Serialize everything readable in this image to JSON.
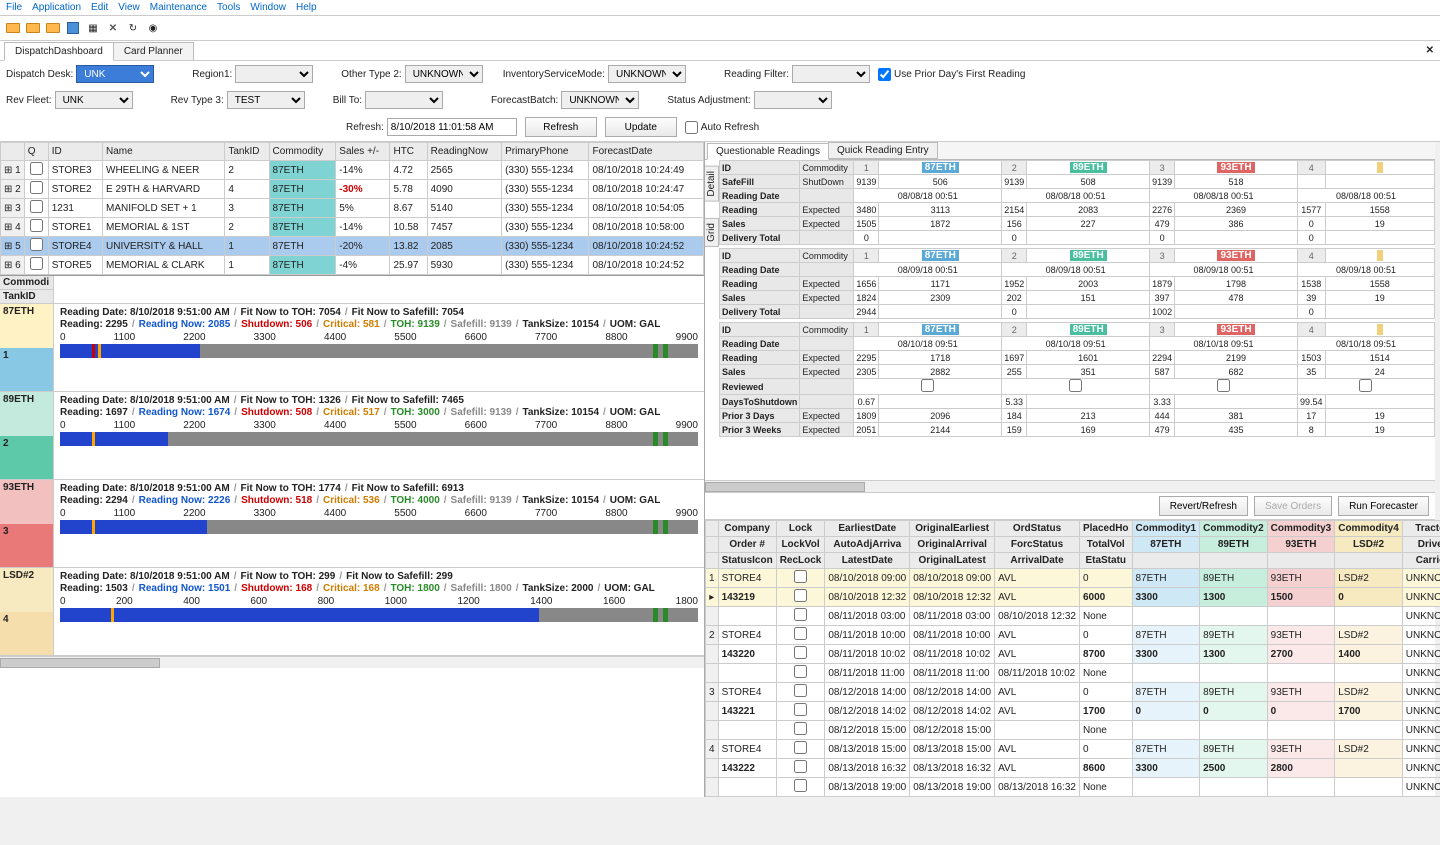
{
  "menu": [
    "File",
    "Application",
    "Edit",
    "View",
    "Maintenance",
    "Tools",
    "Window",
    "Help"
  ],
  "tabs": {
    "dispatch": "DispatchDashboard",
    "card": "Card Planner"
  },
  "filter": {
    "desk_lbl": "Dispatch Desk:",
    "desk": "UNK",
    "region_lbl": "Region1:",
    "region": "",
    "ot2_lbl": "Other Type 2:",
    "ot2": "UNKNOWN",
    "ism_lbl": "InventoryServiceMode:",
    "ism": "UNKNOWN",
    "rf_lbl": "Reading Filter:",
    "rf": "",
    "prior_lbl": "Use Prior Day's First Reading",
    "fleet_lbl": "Rev Fleet:",
    "fleet": "UNK",
    "rt3_lbl": "Rev Type 3:",
    "rt3": "TEST",
    "bill_lbl": "Bill To:",
    "bill": "",
    "fb_lbl": "ForecastBatch:",
    "fb": "UNKNOWN",
    "sa_lbl": "Status Adjustment:",
    "sa": "",
    "refresh_lbl": "Refresh:",
    "refresh_time": "8/10/2018 11:01:58 AM",
    "btn_refresh": "Refresh",
    "btn_update": "Update",
    "auto": "Auto Refresh"
  },
  "grid_cols": [
    "",
    "Q",
    "ID",
    "Name",
    "TankID",
    "Commodity",
    "Sales +/-",
    "HTC",
    "ReadingNow",
    "PrimaryPhone",
    "ForecastDate"
  ],
  "grid_rows": [
    {
      "n": "1",
      "id": "STORE3",
      "name": "WHEELING & NEER",
      "tank": "2",
      "com": "87ETH",
      "sales": "-14%",
      "htc": "4.72",
      "rn": "2565",
      "ph": "(330) 555-1234",
      "fd": "08/10/2018 10:24:49"
    },
    {
      "n": "2",
      "id": "STORE2",
      "name": "E 29TH & HARVARD",
      "tank": "4",
      "com": "87ETH",
      "sales": "-30%",
      "red": true,
      "htc": "5.78",
      "rn": "4090",
      "ph": "(330) 555-1234",
      "fd": "08/10/2018 10:24:47"
    },
    {
      "n": "3",
      "id": "1231",
      "name": "MANIFOLD SET + 1",
      "tank": "3",
      "com": "87ETH",
      "sales": "5%",
      "htc": "8.67",
      "rn": "5140",
      "ph": "(330) 555-1234",
      "fd": "08/10/2018 10:54:05"
    },
    {
      "n": "4",
      "id": "STORE1",
      "name": "MEMORIAL & 1ST",
      "tank": "2",
      "com": "87ETH",
      "sales": "-14%",
      "htc": "10.58",
      "rn": "7457",
      "ph": "(330) 555-1234",
      "fd": "08/10/2018 10:58:00"
    },
    {
      "n": "5",
      "id": "STORE4",
      "name": "UNIVERSITY & HALL",
      "tank": "1",
      "com": "87ETH",
      "sales": "-20%",
      "htc": "13.82",
      "rn": "2085",
      "ph": "(330) 555-1234",
      "fd": "08/10/2018 10:24:52",
      "sel": true
    },
    {
      "n": "6",
      "id": "STORE5",
      "name": "MEMORIAL & CLARK",
      "tank": "1",
      "com": "87ETH",
      "sales": "-4%",
      "htc": "25.97",
      "rn": "5930",
      "ph": "(330) 555-1234",
      "fd": "08/10/2018 10:24:52"
    }
  ],
  "chart_hdr": {
    "com": "Commodi",
    "tank": "TankID"
  },
  "tanks": [
    {
      "code": "87ETH",
      "num": "1",
      "cls": "c87",
      "rdate": "8/10/2018 9:51:00 AM",
      "toh": "7054",
      "sf": "7054",
      "read": "2295",
      "rn": "2085",
      "shut": "506",
      "crit": "581",
      "tohv": "9139",
      "safe": "9139",
      "size": "10154",
      "uom": "GAL",
      "pct": 22,
      "shutp": 5,
      "critp": 6,
      "ticks": [
        "0",
        "1100",
        "2200",
        "3300",
        "4400",
        "5500",
        "6600",
        "7700",
        "8800",
        "9900"
      ]
    },
    {
      "code": "89ETH",
      "num": "2",
      "cls": "c89",
      "rdate": "8/10/2018 9:51:00 AM",
      "toh": "1326",
      "sf": "7465",
      "read": "1697",
      "rn": "1674",
      "shut": "508",
      "crit": "517",
      "tohv": "3000",
      "safe": "9139",
      "size": "10154",
      "uom": "GAL",
      "pct": 17,
      "shutp": 5,
      "critp": 5,
      "ticks": [
        "0",
        "1100",
        "2200",
        "3300",
        "4400",
        "5500",
        "6600",
        "7700",
        "8800",
        "9900"
      ]
    },
    {
      "code": "93ETH",
      "num": "3",
      "cls": "c93",
      "rdate": "8/10/2018 9:51:00 AM",
      "toh": "1774",
      "sf": "6913",
      "read": "2294",
      "rn": "2226",
      "shut": "518",
      "crit": "536",
      "tohv": "4000",
      "safe": "9139",
      "size": "10154",
      "uom": "GAL",
      "pct": 23,
      "shutp": 5,
      "critp": 5,
      "ticks": [
        "0",
        "1100",
        "2200",
        "3300",
        "4400",
        "5500",
        "6600",
        "7700",
        "8800",
        "9900"
      ]
    },
    {
      "code": "LSD#2",
      "num": "4",
      "cls": "cls",
      "rdate": "8/10/2018 9:51:00 AM",
      "toh": "299",
      "sf": "299",
      "read": "1503",
      "rn": "1501",
      "shut": "168",
      "crit": "168",
      "tohv": "1800",
      "safe": "1800",
      "size": "2000",
      "uom": "GAL",
      "pct": 75,
      "shutp": 8,
      "critp": 8,
      "ticks": [
        "0",
        "200",
        "400",
        "600",
        "800",
        "1000",
        "1200",
        "1400",
        "1600",
        "1800"
      ]
    }
  ],
  "text": {
    "readingdate": "Reading Date:",
    "fit_toh": "Fit Now to TOH:",
    "fit_sf": "Fit Now to Safefill:",
    "reading": "Reading:",
    "readingnow": "Reading Now:",
    "shutdown": "Shutdown:",
    "critical": "Critical:",
    "toh": "TOH:",
    "safefill": "Safefill:",
    "tanksize": "TankSize:",
    "uom": "UOM:"
  },
  "rtabs": {
    "qr": "Questionable Readings",
    "qre": "Quick Reading Entry",
    "detail": "Detail",
    "grid": "Grid"
  },
  "qr": {
    "labels": {
      "id": "ID",
      "com": "Commodity",
      "sf": "SafeFill",
      "shut": "ShutDown",
      "rdate": "Reading Date",
      "reading": "Reading",
      "exp": "Expected",
      "sales": "Sales",
      "deliv": "Delivery Total",
      "rev": "Reviewed",
      "dts": "DaysToShutdown",
      "p3d": "Prior 3 Days",
      "p3w": "Prior 3 Weeks"
    },
    "cols": [
      {
        "n": "1",
        "p": "p87",
        "c": "87ETH"
      },
      {
        "n": "2",
        "p": "p89",
        "c": "89ETH"
      },
      {
        "n": "3",
        "p": "p93",
        "c": "93ETH"
      },
      {
        "n": "4",
        "p": "pls",
        "c": ""
      }
    ],
    "g1": {
      "sf": [
        "9139",
        "506",
        "9139",
        "508",
        "9139",
        "518",
        "",
        ""
      ],
      "dt": [
        "08/08/18 00:51",
        "08/08/18 00:51",
        "08/08/18 00:51",
        "08/08/18 00:51"
      ],
      "rd": [
        "3480",
        "3113",
        "2154",
        "2083",
        "2276",
        "2369",
        "1577",
        "1558"
      ],
      "sl": [
        "1505",
        "1872",
        "156",
        "227",
        "479",
        "386",
        "0",
        "19"
      ],
      "dv": [
        "0",
        "",
        "0",
        "",
        "0",
        "",
        "0",
        ""
      ]
    },
    "g2": {
      "dt": [
        "08/09/18 00:51",
        "08/09/18 00:51",
        "08/09/18 00:51",
        "08/09/18 00:51"
      ],
      "rd": [
        "1656",
        "1171",
        "1952",
        "2003",
        "1879",
        "1798",
        "1538",
        "1558"
      ],
      "sl": [
        "1824",
        "2309",
        "202",
        "151",
        "397",
        "478",
        "39",
        "19"
      ],
      "dv": [
        "2944",
        "",
        "0",
        "",
        "1002",
        "",
        "0",
        ""
      ]
    },
    "g3": {
      "dt": [
        "08/10/18 09:51",
        "08/10/18 09:51",
        "08/10/18 09:51",
        "08/10/18 09:51"
      ],
      "rd": [
        "2295",
        "1718",
        "1697",
        "1601",
        "2294",
        "2199",
        "1503",
        "1514"
      ],
      "sl": [
        "2305",
        "2882",
        "255",
        "351",
        "587",
        "682",
        "35",
        "24"
      ],
      "dts": [
        "0.67",
        "",
        "5.33",
        "",
        "3.33",
        "",
        "99.54",
        ""
      ],
      "p3d": [
        "1809",
        "2096",
        "184",
        "213",
        "444",
        "381",
        "17",
        "19"
      ],
      "p3w": [
        "2051",
        "2144",
        "159",
        "169",
        "479",
        "435",
        "8",
        "19"
      ]
    }
  },
  "btns": {
    "rr": "Revert/Refresh",
    "so": "Save Orders",
    "rf": "Run Forecaster"
  },
  "ord_cols1": [
    "",
    "Company",
    "Lock",
    "EarliestDate",
    "OriginalEarliest",
    "OrdStatus",
    "PlacedHo",
    "Commodity1",
    "Commodity2",
    "Commodity3",
    "Commodity4",
    "Tractor"
  ],
  "ord_cols2": [
    "",
    "Order #",
    "LockVol",
    "AutoAdjArriva",
    "OriginalArrival",
    "ForcStatus",
    "TotalVol",
    "87ETH",
    "89ETH",
    "93ETH",
    "LSD#2",
    "Driver"
  ],
  "ord_cols3": [
    "",
    "StatusIcon",
    "RecLock",
    "LatestDate",
    "OriginalLatest",
    "ArrivalDate",
    "EtaStatu",
    "",
    "",
    "",
    "",
    "Carrier"
  ],
  "orders": [
    {
      "n": "1",
      "co": "STORE4",
      "ed": "08/10/2018 09:00",
      "oe": "08/10/2018 09:00",
      "st": "AVL",
      "ph": "0",
      "c1": "87ETH",
      "c2": "89ETH",
      "c3": "93ETH",
      "c4": "LSD#2",
      "tr": "UNKNOWN",
      "yellow": true,
      "ord": "143219",
      "aa": "08/10/2018 12:32",
      "oa": "08/10/2018 12:32",
      "fs": "AVL",
      "tv": "6000",
      "v1": "3300",
      "v2": "1300",
      "v3": "1500",
      "v4": "0",
      "dr": "UNKNOWN",
      "ld": "08/11/2018 03:00",
      "ol": "08/11/2018 03:00",
      "ad": "08/10/2018 12:32",
      "es": "None",
      "ca": "UNKNOWN"
    },
    {
      "n": "2",
      "co": "STORE4",
      "ed": "08/11/2018 10:00",
      "oe": "08/11/2018 10:00",
      "st": "AVL",
      "ph": "0",
      "c1": "87ETH",
      "c2": "89ETH",
      "c3": "93ETH",
      "c4": "LSD#2",
      "tr": "UNKNOWN",
      "ord": "143220",
      "aa": "08/11/2018 10:02",
      "oa": "08/11/2018 10:02",
      "fs": "AVL",
      "tv": "8700",
      "v1": "3300",
      "v2": "1300",
      "v3": "2700",
      "v4": "1400",
      "dr": "UNKNOWN",
      "ld": "08/11/2018 11:00",
      "ol": "08/11/2018 11:00",
      "ad": "08/11/2018 10:02",
      "es": "None",
      "ca": "UNKNOWN"
    },
    {
      "n": "3",
      "co": "STORE4",
      "ed": "08/12/2018 14:00",
      "oe": "08/12/2018 14:00",
      "st": "AVL",
      "ph": "0",
      "c1": "87ETH",
      "c2": "89ETH",
      "c3": "93ETH",
      "c4": "LSD#2",
      "tr": "UNKNOWN",
      "ord": "143221",
      "aa": "08/12/2018 14:02",
      "oa": "08/12/2018 14:02",
      "fs": "AVL",
      "tv": "1700",
      "v1": "0",
      "v2": "0",
      "v3": "0",
      "v4": "1700",
      "dr": "UNKNOWN",
      "ld": "08/12/2018 15:00",
      "ol": "08/12/2018 15:00",
      "ad": "",
      "es": "None",
      "ca": "UNKNOWN"
    },
    {
      "n": "4",
      "co": "STORE4",
      "ed": "08/13/2018 15:00",
      "oe": "08/13/2018 15:00",
      "st": "AVL",
      "ph": "0",
      "c1": "87ETH",
      "c2": "89ETH",
      "c3": "93ETH",
      "c4": "LSD#2",
      "tr": "UNKNOWN",
      "ord": "143222",
      "aa": "08/13/2018 16:32",
      "oa": "08/13/2018 16:32",
      "fs": "AVL",
      "tv": "8600",
      "v1": "3300",
      "v2": "2500",
      "v3": "2800",
      "v4": "",
      "dr": "UNKNOWN",
      "ld": "08/13/2018 19:00",
      "ol": "08/13/2018 19:00",
      "ad": "08/13/2018 16:32",
      "es": "None",
      "ca": "UNKNOWN"
    }
  ]
}
